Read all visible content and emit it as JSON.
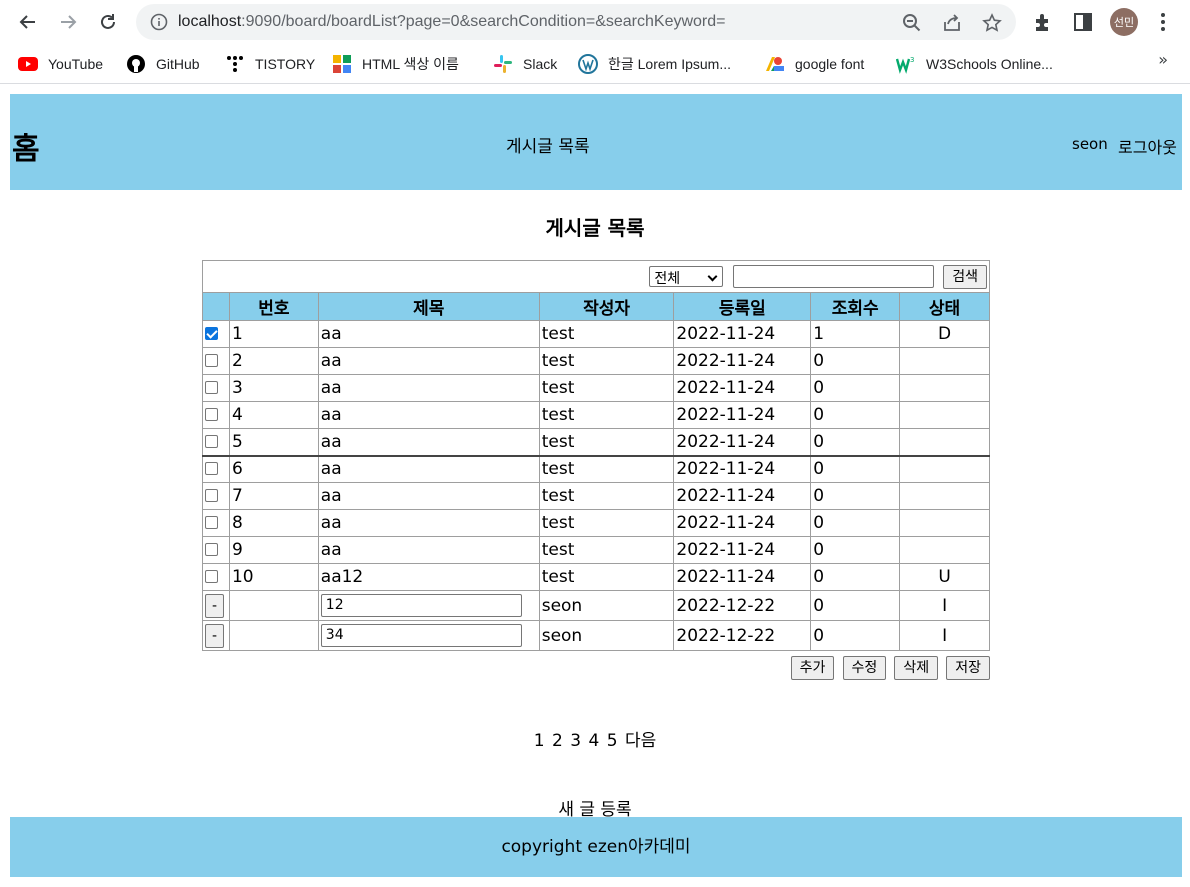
{
  "browser": {
    "url_host": "localhost",
    "url_rest": ":9090/board/boardList?page=0&searchCondition=&searchKeyword=",
    "avatar_text": "선민",
    "bookmarks": [
      {
        "label": "YouTube",
        "icon": "youtube-icon"
      },
      {
        "label": "GitHub",
        "icon": "github-icon"
      },
      {
        "label": "TISTORY",
        "icon": "tistory-icon"
      },
      {
        "label": "HTML 색상 이름",
        "icon": "color-grid-icon"
      },
      {
        "label": "Slack",
        "icon": "slack-icon"
      },
      {
        "label": "한글 Lorem Ipsum...",
        "icon": "wordpress-icon"
      },
      {
        "label": "google font",
        "icon": "google-fonts-icon"
      },
      {
        "label": "W3Schools Online...",
        "icon": "w3schools-icon"
      }
    ],
    "more_label": "»"
  },
  "header": {
    "home": "홈",
    "title": "게시글 목록",
    "user": "seon",
    "logout": "로그아웃"
  },
  "page_title": "게시글 목록",
  "search": {
    "condition": "전체",
    "keyword": "",
    "button": "검색"
  },
  "table": {
    "columns": [
      "번호",
      "제목",
      "작성자",
      "등록일",
      "조회수",
      "상태"
    ],
    "rows": [
      {
        "checked": true,
        "no": "1",
        "title": "aa",
        "writer": "test",
        "date": "2022-11-24",
        "views": "1",
        "status": "D"
      },
      {
        "checked": false,
        "no": "2",
        "title": "aa",
        "writer": "test",
        "date": "2022-11-24",
        "views": "0",
        "status": ""
      },
      {
        "checked": false,
        "no": "3",
        "title": "aa",
        "writer": "test",
        "date": "2022-11-24",
        "views": "0",
        "status": ""
      },
      {
        "checked": false,
        "no": "4",
        "title": "aa",
        "writer": "test",
        "date": "2022-11-24",
        "views": "0",
        "status": ""
      },
      {
        "checked": false,
        "no": "5",
        "title": "aa",
        "writer": "test",
        "date": "2022-11-24",
        "views": "0",
        "status": ""
      },
      {
        "checked": false,
        "no": "6",
        "title": "aa",
        "writer": "test",
        "date": "2022-11-24",
        "views": "0",
        "status": ""
      },
      {
        "checked": false,
        "no": "7",
        "title": "aa",
        "writer": "test",
        "date": "2022-11-24",
        "views": "0",
        "status": ""
      },
      {
        "checked": false,
        "no": "8",
        "title": "aa",
        "writer": "test",
        "date": "2022-11-24",
        "views": "0",
        "status": ""
      },
      {
        "checked": false,
        "no": "9",
        "title": "aa",
        "writer": "test",
        "date": "2022-11-24",
        "views": "0",
        "status": ""
      },
      {
        "checked": false,
        "no": "10",
        "title": "aa12",
        "writer": "test",
        "date": "2022-11-24",
        "views": "0",
        "status": "U"
      }
    ],
    "new_rows": [
      {
        "button": "-",
        "title": "12",
        "writer": "seon",
        "date": "2022-12-22",
        "views": "0",
        "status": "I"
      },
      {
        "button": "-",
        "title": "34",
        "writer": "seon",
        "date": "2022-12-22",
        "views": "0",
        "status": "I"
      }
    ]
  },
  "actions": {
    "add": "추가",
    "edit": "수정",
    "delete": "삭제",
    "save": "저장"
  },
  "pager": {
    "pages": [
      "1",
      "2",
      "3",
      "4",
      "5"
    ],
    "next": "다음"
  },
  "new_post": "새 글 등록",
  "footer": "copyright ezen아카데미"
}
